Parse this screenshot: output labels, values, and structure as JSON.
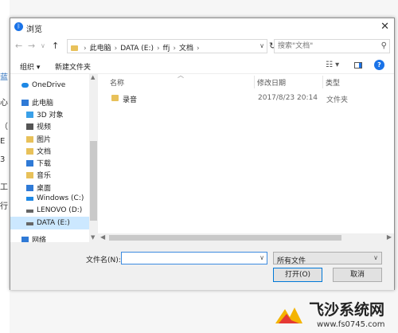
{
  "window": {
    "title": "浏览"
  },
  "background": {
    "fragments": [
      "蓝",
      "心",
      "（",
      "E",
      "3",
      "工",
      "行"
    ]
  },
  "address": {
    "crumbs": [
      "此电脑",
      "DATA (E:)",
      "ffj",
      "文档"
    ],
    "search_placeholder": "搜索\"文档\""
  },
  "toolbar": {
    "organize": "组织 ▾",
    "new_folder": "新建文件夹"
  },
  "nav": {
    "items": [
      {
        "label": "OneDrive",
        "icon": "onedrive-icon",
        "color": "#1e88e5"
      },
      {
        "label": "此电脑",
        "icon": "pc-icon",
        "color": "#2f7ad6"
      },
      {
        "label": "3D 对象",
        "icon": "3d-objects-icon",
        "color": "#3aa0e8"
      },
      {
        "label": "视频",
        "icon": "video-icon",
        "color": "#555555"
      },
      {
        "label": "图片",
        "icon": "pictures-icon",
        "color": "#e8c15a"
      },
      {
        "label": "文档",
        "icon": "documents-icon",
        "color": "#e8c15a"
      },
      {
        "label": "下载",
        "icon": "downloads-icon",
        "color": "#2f7ad6"
      },
      {
        "label": "音乐",
        "icon": "music-icon",
        "color": "#e8c15a"
      },
      {
        "label": "桌面",
        "icon": "desktop-icon",
        "color": "#2f7ad6"
      },
      {
        "label": "Windows (C:)",
        "icon": "drive-c-icon",
        "color": "#1e88e5"
      },
      {
        "label": "LENOVO (D:)",
        "icon": "drive-d-icon",
        "color": "#666666"
      },
      {
        "label": "DATA (E:)",
        "icon": "drive-e-icon",
        "color": "#666666"
      },
      {
        "label": "网络",
        "icon": "network-icon",
        "color": "#2f7ad6"
      }
    ]
  },
  "columns": {
    "name": "名称",
    "date": "修改日期",
    "type": "类型"
  },
  "files": [
    {
      "name": "录音",
      "date": "2017/8/23 20:14",
      "type": "文件夹"
    }
  ],
  "footer": {
    "filename_label": "文件名(N):",
    "filename_value": "",
    "filter_value": "所有文件",
    "open": "打开(O)",
    "cancel": "取消"
  },
  "watermark": {
    "text": "飞沙系统网",
    "url": "www.fs0745.com"
  },
  "colors": {
    "accent": "#1a73e8",
    "selection": "#cce8ff",
    "folder": "#e8c15a"
  }
}
